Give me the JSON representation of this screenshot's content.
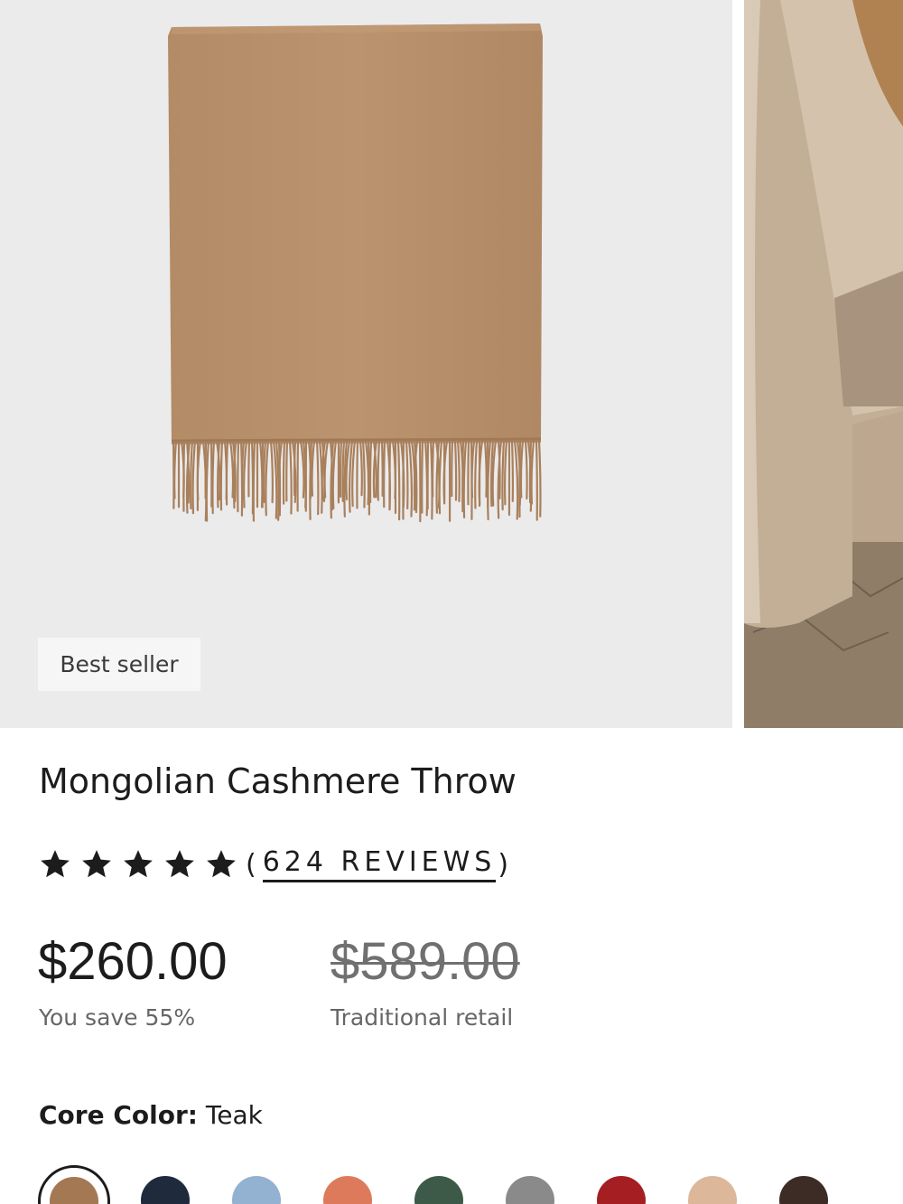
{
  "product": {
    "badge": "Best seller",
    "title": "Mongolian Cashmere Throw",
    "rating": 5,
    "reviews_open": "(",
    "reviews_label": "624 REVIEWS",
    "reviews_close": ")",
    "price": "$260.00",
    "savings": "You save 55%",
    "retail_price": "$589.00",
    "retail_label": "Traditional retail"
  },
  "color": {
    "label": "Core Color:",
    "selected": "Teak",
    "swatches": [
      "#a47852",
      "#1f2a3c",
      "#93b1d0",
      "#de7a5c",
      "#3c5a47",
      "#8a8a8a",
      "#a41e22",
      "#dcb79a",
      "#3d2c25"
    ]
  },
  "colors": {
    "image_bg": "#ebebec",
    "throw": "#b8916c",
    "text": "#1c1c1c"
  }
}
